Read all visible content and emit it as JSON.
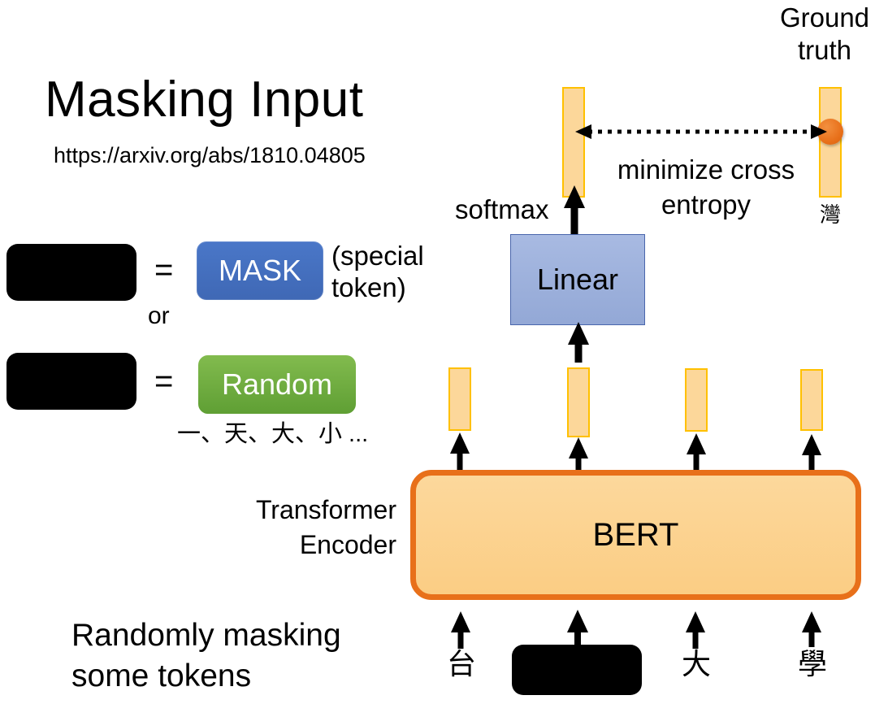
{
  "slide": {
    "title": "Masking Input",
    "paper_url": "https://arxiv.org/abs/1810.04805",
    "background_color": "#ffffff"
  },
  "legend": {
    "equals_1": "=",
    "equals_2": "=",
    "or_label": "or",
    "mask_pill_label": "MASK",
    "mask_pill_color": "#4472c4",
    "special_token_note": "(special\ntoken)",
    "random_pill_label": "Random",
    "random_pill_color": "#6aae3e",
    "random_examples": "一、天、大、小 ...",
    "black_token_color": "#000000"
  },
  "captions": {
    "bottom_left": "Randomly masking\nsome tokens",
    "encoder_label": "Transformer\nEncoder",
    "ground_truth_label": "Ground\ntruth",
    "softmax_label": "softmax",
    "cross_entropy_label": "minimize cross\nentropy"
  },
  "model": {
    "linear_label": "Linear",
    "linear_fill": "#9db0dc",
    "linear_border": "#4a66ac",
    "bert_label": "BERT",
    "bert_fill": "#fcd79a",
    "bert_border": "#e8701a"
  },
  "vectors": {
    "fill": "#fcd79a",
    "border": "#ffc000",
    "output_count": 4,
    "ground_truth_char": "灣",
    "ground_truth_dot_color": "#e8701a"
  },
  "input_tokens": [
    {
      "label": "台",
      "masked": false
    },
    {
      "label": "",
      "masked": true
    },
    {
      "label": "大",
      "masked": false
    },
    {
      "label": "學",
      "masked": false
    }
  ]
}
